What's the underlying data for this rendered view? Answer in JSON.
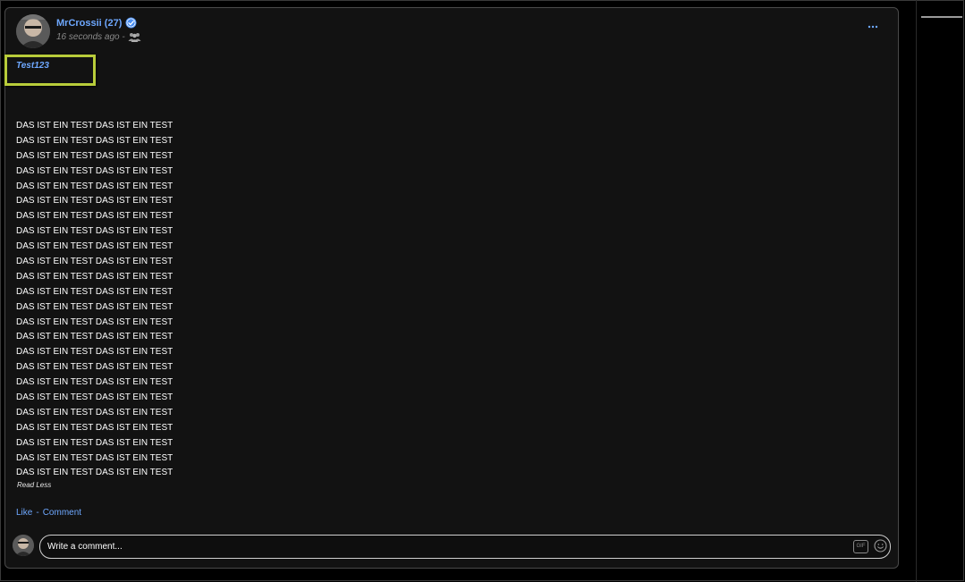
{
  "post": {
    "author": "MrCrossii (27)",
    "timestamp": "16 seconds ago -",
    "audience_icon": "group-icon",
    "verified_icon": "verified-check-icon",
    "title": "Test123",
    "body_lines": [
      "DAS IST EIN TEST DAS IST EIN TEST",
      "DAS IST EIN TEST DAS IST EIN TEST",
      "DAS IST EIN TEST DAS IST EIN TEST",
      "DAS IST EIN TEST DAS IST EIN TEST",
      "DAS IST EIN TEST DAS IST EIN TEST",
      "DAS IST EIN TEST DAS IST EIN TEST",
      "DAS IST EIN TEST DAS IST EIN TEST",
      "DAS IST EIN TEST DAS IST EIN TEST",
      "DAS IST EIN TEST DAS IST EIN TEST",
      "DAS IST EIN TEST DAS IST EIN TEST",
      "DAS IST EIN TEST DAS IST EIN TEST",
      "DAS IST EIN TEST DAS IST EIN TEST",
      "DAS IST EIN TEST DAS IST EIN TEST",
      "DAS IST EIN TEST DAS IST EIN TEST",
      "DAS IST EIN TEST DAS IST EIN TEST",
      "DAS IST EIN TEST DAS IST EIN TEST",
      "DAS IST EIN TEST DAS IST EIN TEST",
      "DAS IST EIN TEST DAS IST EIN TEST",
      "DAS IST EIN TEST DAS IST EIN TEST",
      "DAS IST EIN TEST DAS IST EIN TEST",
      "DAS IST EIN TEST DAS IST EIN TEST",
      "DAS IST EIN TEST DAS IST EIN TEST",
      "DAS IST EIN TEST DAS IST EIN TEST",
      "DAS IST EIN TEST DAS IST EIN TEST"
    ],
    "read_less_label": "Read Less",
    "like_label": "Like",
    "separator": "-",
    "comment_label": "Comment",
    "more_icon": "more-dots-icon"
  },
  "comment_composer": {
    "placeholder": "Write a comment...",
    "gif_label": "GIF",
    "emoji_icon": "smiley-icon"
  },
  "colors": {
    "background": "#000000",
    "card": "#121212",
    "link": "#6ea8ff",
    "highlight_box": "#b8cc3a",
    "text": "#ffffff",
    "muted": "#8a8a8a"
  }
}
